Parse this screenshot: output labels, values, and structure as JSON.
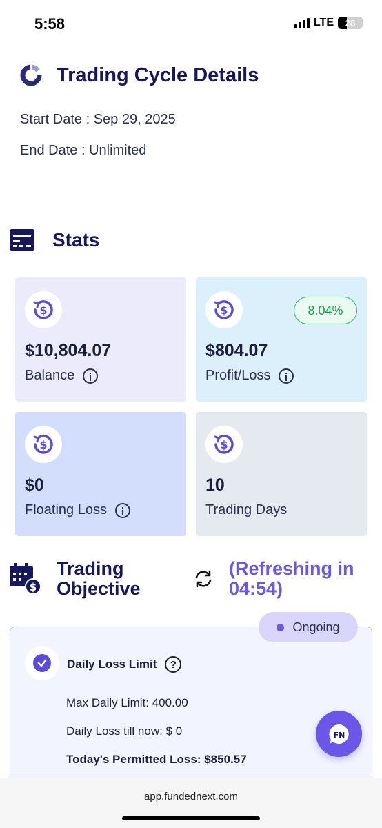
{
  "status_bar": {
    "time": "5:58",
    "network": "LTE",
    "battery": "28"
  },
  "cycle": {
    "title": "Trading Cycle Details",
    "start_date": "Start Date : Sep 29, 2025",
    "end_date": "End Date : Unlimited"
  },
  "stats": {
    "title": "Stats",
    "cards": [
      {
        "value": "$10,804.07",
        "label": "Balance",
        "bg": "#ecebfb"
      },
      {
        "value": "$804.07",
        "label": "Profit/Loss",
        "badge": "8.04%",
        "bg": "#dcf0fb"
      },
      {
        "value": "$0",
        "label": "Floating Loss",
        "bg": "#d2defb"
      },
      {
        "value": "10",
        "label": "Trading Days",
        "bg": "#e4eaef"
      }
    ]
  },
  "objective": {
    "title": "Trading Objective",
    "refreshing": "(Refreshing in 04:54)",
    "status": "Ongoing",
    "rule_title": "Daily Loss Limit",
    "lines": [
      "Max Daily Limit: 400.00",
      "Daily Loss till now: $ 0",
      "Today's Permitted Loss: $850.57"
    ]
  },
  "browser": {
    "url": "app.fundednext.com"
  },
  "colors": {
    "accent": "#6a57e8",
    "heading": "#17175e",
    "success": "#1f9a55"
  }
}
